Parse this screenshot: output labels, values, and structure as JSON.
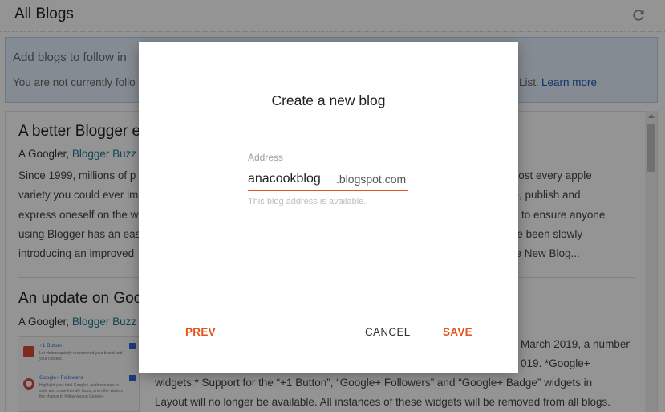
{
  "header": {
    "title": "All Blogs",
    "refresh_icon": "refresh-icon"
  },
  "follow_panel": {
    "heading": "Add blogs to follow in",
    "sub": "You are not currently follo",
    "list_text": "List.",
    "learn_more": "Learn more"
  },
  "posts": [
    {
      "title": "A better Blogger e",
      "meta_prefix": "A Googler,",
      "meta_link": "Blogger Buzz",
      "body_left": [
        "Since 1999, millions of p",
        "variety you could ever im",
        "express oneself on the w",
        "using Blogger has an eas",
        "introducing an improved"
      ],
      "body_right": [
        "most every apple",
        "re, publish and",
        "nt to ensure anyone",
        "'ve been slowly",
        "he New Blog..."
      ]
    },
    {
      "title": "An update on Goo",
      "meta_prefix": "A Googler,",
      "meta_link": "Blogger Buzz",
      "body_right": [
        "March 2019, a number",
        "019. *Google+"
      ],
      "body_full": [
        "widgets:* Support for the “+1 Button”, “Google+ Followers” and “Google+ Badge” widgets in",
        "Layout will no longer be available. All instances of these widgets will be removed from all blogs."
      ],
      "thumb": [
        {
          "title": "+1 Button",
          "desc": "Let visitors quickly recommend your brand and your content."
        },
        {
          "title": "Google+ Followers",
          "desc": "Highlight your total Google+ audience size in style and some friendly faces, and offer visitors the chance to follow you on Google+"
        }
      ]
    }
  ],
  "dialog": {
    "title": "Create a new blog",
    "address_label": "Address",
    "address_value": "anacookblog",
    "address_suffix": ".blogspot.com",
    "hint": "This blog address is available.",
    "prev": "PREV",
    "cancel": "CANCEL",
    "save": "SAVE"
  },
  "colors": {
    "accent": "#e6531d",
    "link": "#1a57b8",
    "overlay": "rgba(0,0,0,0.42)"
  }
}
